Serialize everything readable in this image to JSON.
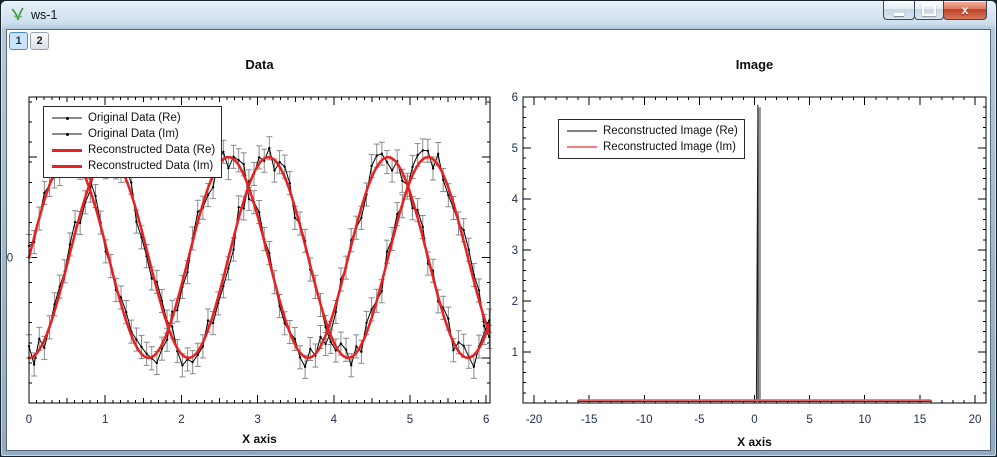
{
  "window": {
    "title": "ws-1",
    "icon": "mantid-logo-icon",
    "controls": [
      "minimize",
      "maximize",
      "close"
    ]
  },
  "tabs": [
    {
      "label": "1",
      "active": true
    },
    {
      "label": "2",
      "active": false
    }
  ],
  "chart_data": [
    {
      "type": "line",
      "title": "Data",
      "xlabel": "X axis",
      "xlim": [
        0,
        6.05
      ],
      "ylim": [
        -1.45,
        1.6
      ],
      "x_ticks": {
        "major": [
          0,
          1,
          2,
          3,
          4,
          5,
          6
        ],
        "labels": [
          "0",
          "1",
          "2",
          "3",
          "4",
          "5",
          "6"
        ],
        "medium_step": 0.5,
        "minor_step": 0.1
      },
      "y_ticks": {
        "major": [
          -1,
          0,
          1
        ],
        "minor_step": 0.2,
        "edge_label": {
          "value": 0,
          "text": "0"
        }
      },
      "legend_position": "top-left",
      "seed": 12345,
      "series": [
        {
          "name": "Original Data (Re)",
          "kind": "noisy",
          "model": {
            "amp": 1,
            "freq": 3,
            "phase": 0
          },
          "noise": 0.12,
          "error_bar": 0.115,
          "n": 91,
          "data_range": [
            0,
            6.04
          ],
          "color": "#000000",
          "errorbar_color": "#8a8a8a",
          "marker": "dot"
        },
        {
          "name": "Original Data (Im)",
          "kind": "noisy",
          "model": {
            "amp": 1,
            "freq": 3,
            "phase": -1.5707963
          },
          "noise": 0.12,
          "error_bar": 0.115,
          "n": 91,
          "data_range": [
            0,
            6.04
          ],
          "color": "#000000",
          "errorbar_color": "#8a8a8a",
          "marker": "dot"
        },
        {
          "name": "Reconstructed Data (Re)",
          "kind": "smooth",
          "model": {
            "amp": 1,
            "freq": 3,
            "phase": 0
          },
          "color": "#e82020",
          "width": 2.5
        },
        {
          "name": "Reconstructed Data (Im)",
          "kind": "smooth",
          "model": {
            "amp": 1,
            "freq": 3,
            "phase": -1.5707963
          },
          "color": "#e82020",
          "width": 2.5
        }
      ]
    },
    {
      "type": "line",
      "title": "Image",
      "xlabel": "X axis",
      "xlim": [
        -21,
        21
      ],
      "ylim": [
        0,
        6
      ],
      "x_ticks": {
        "major": [
          -20,
          -15,
          -10,
          -5,
          0,
          5,
          10,
          15,
          20
        ],
        "labels": [
          "-20",
          "-15",
          "-10",
          "-5",
          "0",
          "5",
          "10",
          "15",
          "20"
        ],
        "minor_step": 1
      },
      "y_ticks": {
        "major": [
          1,
          2,
          3,
          4,
          5,
          6
        ],
        "labels": [
          "1",
          "2",
          "3",
          "4",
          "5",
          "6"
        ],
        "minor_step": 0.2
      },
      "legend_position": "top-center",
      "series": [
        {
          "name": "Reconstructed Image (Re)",
          "kind": "spike",
          "spike_x": 0.45,
          "peak": 5.85,
          "baseline": 0.03,
          "base_range": [
            -16,
            16
          ],
          "color": "#808080",
          "line_color": "#1a1a1a",
          "shadow_color": "#989898"
        },
        {
          "name": "Reconstructed Image (Im)",
          "kind": "flat",
          "y": 0.055,
          "range": [
            -16,
            16
          ],
          "width": 2,
          "color": "#f08080",
          "plot_color": "#da6262"
        }
      ]
    }
  ]
}
